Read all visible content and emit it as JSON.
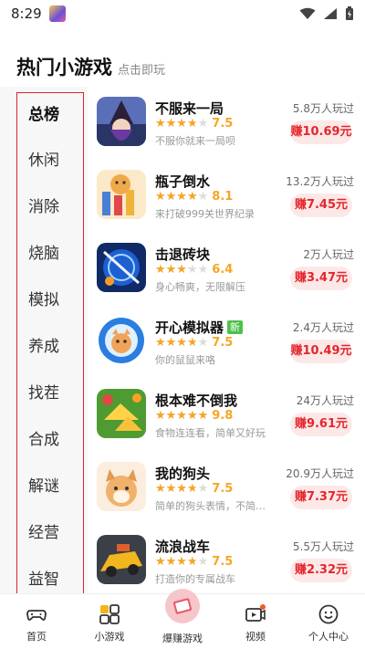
{
  "status_bar": {
    "time": "8:29"
  },
  "header": {
    "title": "热门小游戏",
    "subtitle": "点击即玩"
  },
  "categories": [
    {
      "label": "总榜",
      "active": true
    },
    {
      "label": "休闲"
    },
    {
      "label": "消除"
    },
    {
      "label": "烧脑"
    },
    {
      "label": "模拟"
    },
    {
      "label": "养成"
    },
    {
      "label": "找茬"
    },
    {
      "label": "合成"
    },
    {
      "label": "解谜"
    },
    {
      "label": "经营"
    },
    {
      "label": "益智"
    }
  ],
  "games": [
    {
      "name": "不服来一局",
      "tag": "",
      "rating": 7.5,
      "stars_fraction": 0.75,
      "desc": "不服你就来一局呗",
      "plays": "5.8万人玩过",
      "earn": "赚10.69元"
    },
    {
      "name": "瓶子倒水",
      "tag": "",
      "rating": 8.1,
      "stars_fraction": 0.81,
      "desc": "来打破999关世界纪录",
      "plays": "13.2万人玩过",
      "earn": "赚7.45元"
    },
    {
      "name": "击退砖块",
      "tag": "",
      "rating": 6.4,
      "stars_fraction": 0.64,
      "desc": "身心畅爽，无限解压",
      "plays": "2万人玩过",
      "earn": "赚3.47元"
    },
    {
      "name": "开心模拟器",
      "tag": "新",
      "rating": 7.5,
      "stars_fraction": 0.75,
      "desc": "你的鼠鼠来咯",
      "plays": "2.4万人玩过",
      "earn": "赚10.49元"
    },
    {
      "name": "根本难不倒我",
      "tag": "",
      "rating": 9.8,
      "stars_fraction": 0.98,
      "desc": "食物连连看，简单又好玩",
      "plays": "24万人玩过",
      "earn": "赚9.61元"
    },
    {
      "name": "我的狗头",
      "tag": "",
      "rating": 7.5,
      "stars_fraction": 0.75,
      "desc": "简单的狗头表情，不简单...",
      "plays": "20.9万人玩过",
      "earn": "赚7.37元"
    },
    {
      "name": "流浪战车",
      "tag": "",
      "rating": 7.5,
      "stars_fraction": 0.75,
      "desc": "打造你的专属战车",
      "plays": "5.5万人玩过",
      "earn": "赚2.32元"
    }
  ],
  "tabbar": [
    {
      "label": "首页",
      "icon": "gamepad-icon"
    },
    {
      "label": "小游戏",
      "icon": "grid-icon",
      "active": true
    },
    {
      "label": "爆赚游戏",
      "icon": "cash-icon"
    },
    {
      "label": "视频",
      "icon": "video-icon"
    },
    {
      "label": "个人中心",
      "icon": "face-icon"
    }
  ],
  "colors": {
    "accent_red": "#e4262b",
    "star": "#f5a623",
    "earn_bg": "#fde8e8",
    "new_tag": "#4cc14a"
  }
}
